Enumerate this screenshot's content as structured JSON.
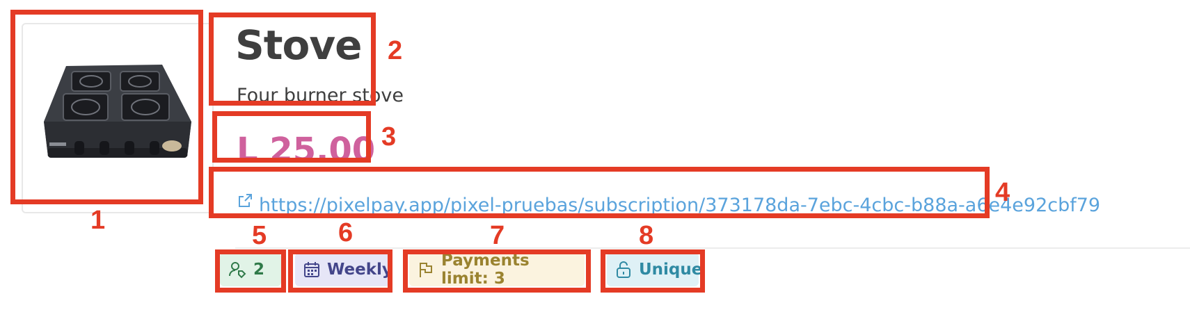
{
  "product": {
    "title": "Stove",
    "description": "Four burner stove",
    "price": "L 25.00",
    "link": "https://pixelpay.app/pixel-pruebas/subscription/373178da-7ebc-4cbc-b88a-a6e4e92cbf79"
  },
  "badges": {
    "customers_count": "2",
    "frequency": "Weekly",
    "payments_limit": "Payments limit: 3",
    "type": "Unique"
  },
  "callouts": [
    "1",
    "2",
    "3",
    "4",
    "5",
    "6",
    "7",
    "8"
  ],
  "colors": {
    "annotation": "#e43b25",
    "price": "#cf619d",
    "link": "#5aa3dc",
    "customers_chip_bg": "#e1f3e7",
    "customers_chip_fg": "#2f7a49",
    "frequency_chip_bg": "#e6e6f7",
    "frequency_chip_fg": "#43458a",
    "limit_chip_bg": "#fbf3df",
    "limit_chip_fg": "#9a8330",
    "unique_chip_bg": "#dff1f6",
    "unique_chip_fg": "#2f8aa3"
  },
  "icons": {
    "link": "external-link-icon",
    "customers": "user-tag-icon",
    "frequency": "calendar-icon",
    "limit": "flag-icon",
    "type": "unlock-icon"
  }
}
